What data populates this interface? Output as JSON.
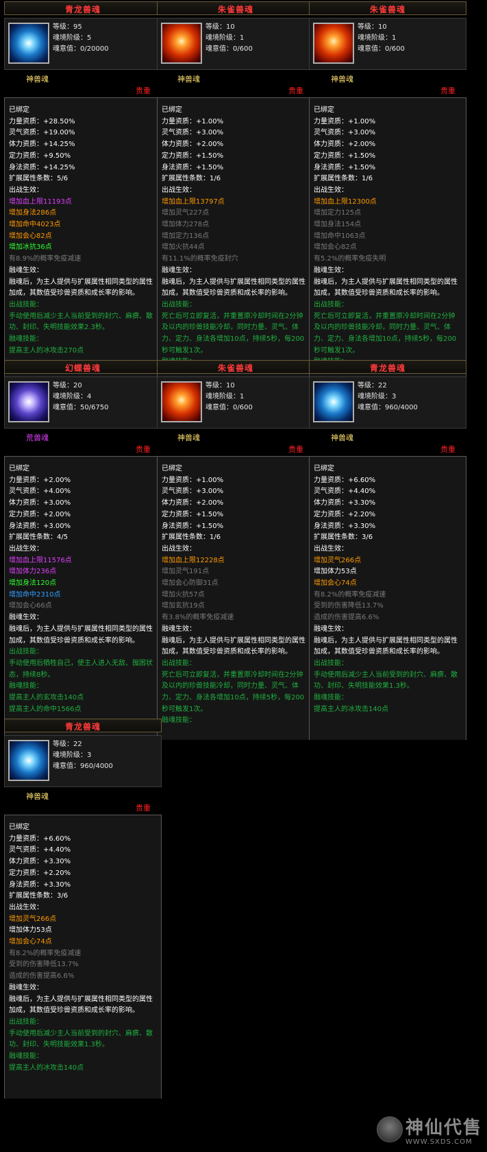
{
  "cards": [
    {
      "title": "青龙兽魂",
      "icon": "qinglong-soul-icon",
      "level": "等级：95",
      "realm": "魂境阶级：5",
      "soul_value": "魂意值：0/20000",
      "soul_type": "神兽魂",
      "soul_type_color": "#ffe070",
      "rarity": "贵重",
      "lines": [
        {
          "text": "已绑定",
          "color": "#ffffff"
        },
        {
          "text": "力量资质：+28.50%",
          "color": "#ffffff"
        },
        {
          "text": "灵气资质：+19.00%",
          "color": "#ffffff"
        },
        {
          "text": "体力资质：+14.25%",
          "color": "#ffffff"
        },
        {
          "text": "定力资质：+9.50%",
          "color": "#ffffff"
        },
        {
          "text": "身法资质：+14.25%",
          "color": "#ffffff"
        },
        {
          "text": "扩展属性条数：5/6",
          "color": "#ffffff"
        },
        {
          "text": "出战生效：",
          "color": "#ffffff"
        },
        {
          "text": "增加血上限11193点",
          "color": "#e040ff"
        },
        {
          "text": "增加身法286点",
          "color": "#ff9a00"
        },
        {
          "text": "增加命中4023点",
          "color": "#ff9a00"
        },
        {
          "text": "增加会心82点",
          "color": "#ff9a00"
        },
        {
          "text": "增加冰抗36点",
          "color": "#30ff30"
        },
        {
          "text": "有8.9%的概率免疫减速",
          "color": "#7a7a7a"
        },
        {
          "text": "融魂生效：",
          "color": "#ffffff"
        },
        {
          "text": "融魂后，为主人提供与扩展属性相同类型的属性加成，其数值受珍兽资质和成长率的影响。",
          "color": "#ffffff"
        },
        {
          "text": "出战技能：",
          "color": "#20b040"
        },
        {
          "text": "手动使用后减少主人当前受到的封穴、麻痹、散功、封印、失明技能效果2.3秒。",
          "color": "#20b040"
        },
        {
          "text": "融魂技能：",
          "color": "#20b040"
        },
        {
          "text": "提高主人的冰攻击270点",
          "color": "#20b040"
        }
      ]
    },
    {
      "title": "朱雀兽魂",
      "icon": "zhuque-soul-icon",
      "level": "等级：10",
      "realm": "魂境阶级：1",
      "soul_value": "魂意值：0/600",
      "soul_type": "神兽魂",
      "soul_type_color": "#ffe070",
      "rarity": "贵重",
      "lines": [
        {
          "text": "已绑定",
          "color": "#ffffff"
        },
        {
          "text": "力量资质：+1.00%",
          "color": "#ffffff"
        },
        {
          "text": "灵气资质：+3.00%",
          "color": "#ffffff"
        },
        {
          "text": "体力资质：+2.00%",
          "color": "#ffffff"
        },
        {
          "text": "定力资质：+1.50%",
          "color": "#ffffff"
        },
        {
          "text": "身法资质：+1.50%",
          "color": "#ffffff"
        },
        {
          "text": "扩展属性条数：1/6",
          "color": "#ffffff"
        },
        {
          "text": "出战生效：",
          "color": "#ffffff"
        },
        {
          "text": "增加血上限13797点",
          "color": "#ff9a00"
        },
        {
          "text": "增加灵气227点",
          "color": "#7a7a7a"
        },
        {
          "text": "增加体力278点",
          "color": "#7a7a7a"
        },
        {
          "text": "增加定力136点",
          "color": "#7a7a7a"
        },
        {
          "text": "增加火抗44点",
          "color": "#7a7a7a"
        },
        {
          "text": "有11.1%的概率免疫封穴",
          "color": "#7a7a7a"
        },
        {
          "text": "融魂生效：",
          "color": "#ffffff"
        },
        {
          "text": "融魂后，为主人提供与扩展属性相同类型的属性加成，其数值受珍兽资质和成长率的影响。",
          "color": "#ffffff"
        },
        {
          "text": "出战技能：",
          "color": "#20b040"
        },
        {
          "text": "死亡后可立即复活，并重置原冷却时间在2分钟及以内的珍兽技能冷却，同时力量、灵气、体力、定力、身法各增加10点，持续5秒，每200秒可触发1次。",
          "color": "#20b040"
        },
        {
          "text": "融魂技能：",
          "color": "#20b040"
        }
      ]
    },
    {
      "title": "朱雀兽魂",
      "icon": "zhuque-soul-icon",
      "level": "等级：10",
      "realm": "魂境阶级：1",
      "soul_value": "魂意值：0/600",
      "soul_type": "神兽魂",
      "soul_type_color": "#ffe070",
      "rarity": "贵重",
      "lines": [
        {
          "text": "已绑定",
          "color": "#ffffff"
        },
        {
          "text": "力量资质：+1.00%",
          "color": "#ffffff"
        },
        {
          "text": "灵气资质：+3.00%",
          "color": "#ffffff"
        },
        {
          "text": "体力资质：+2.00%",
          "color": "#ffffff"
        },
        {
          "text": "定力资质：+1.50%",
          "color": "#ffffff"
        },
        {
          "text": "身法资质：+1.50%",
          "color": "#ffffff"
        },
        {
          "text": "扩展属性条数：1/6",
          "color": "#ffffff"
        },
        {
          "text": "出战生效：",
          "color": "#ffffff"
        },
        {
          "text": "增加血上限12300点",
          "color": "#ff9a00"
        },
        {
          "text": "增加定力125点",
          "color": "#7a7a7a"
        },
        {
          "text": "增加身法154点",
          "color": "#7a7a7a"
        },
        {
          "text": "增加命中1063点",
          "color": "#7a7a7a"
        },
        {
          "text": "增加会心82点",
          "color": "#7a7a7a"
        },
        {
          "text": "有5.2%的概率免疫失明",
          "color": "#7a7a7a"
        },
        {
          "text": "融魂生效：",
          "color": "#ffffff"
        },
        {
          "text": "融魂后，为主人提供与扩展属性相同类型的属性加成，其数值受珍兽资质和成长率的影响。",
          "color": "#ffffff"
        },
        {
          "text": "出战技能：",
          "color": "#20b040"
        },
        {
          "text": "死亡后可立即复活，并重置原冷却时间在2分钟及以内的珍兽技能冷却，同时力量、灵气、体力、定力、身法各增加10点，持续5秒，每200秒可触发1次。",
          "color": "#20b040"
        },
        {
          "text": "融魂技能：",
          "color": "#20b040"
        }
      ]
    },
    {
      "title": "幻蝶兽魂",
      "icon": "huandie-soul-icon",
      "level": "等级：20",
      "realm": "魂境阶级：4",
      "soul_value": "魂意值：50/6750",
      "soul_type": "荒兽魂",
      "soul_type_color": "#e040ff",
      "rarity": "贵重",
      "lines": [
        {
          "text": "已绑定",
          "color": "#ffffff"
        },
        {
          "text": "力量资质：+2.00%",
          "color": "#ffffff"
        },
        {
          "text": "灵气资质：+4.00%",
          "color": "#ffffff"
        },
        {
          "text": "体力资质：+3.00%",
          "color": "#ffffff"
        },
        {
          "text": "定力资质：+2.00%",
          "color": "#ffffff"
        },
        {
          "text": "身法资质：+3.00%",
          "color": "#ffffff"
        },
        {
          "text": "扩展属性条数：4/5",
          "color": "#ffffff"
        },
        {
          "text": "出战生效：",
          "color": "#ffffff"
        },
        {
          "text": "增加血上限11576点",
          "color": "#e040ff"
        },
        {
          "text": "增加体力236点",
          "color": "#e040ff"
        },
        {
          "text": "增加身法120点",
          "color": "#30ff30"
        },
        {
          "text": "增加命中2310点",
          "color": "#30a0ff"
        },
        {
          "text": "增加会心66点",
          "color": "#7a7a7a"
        },
        {
          "text": "融魂生效：",
          "color": "#ffffff"
        },
        {
          "text": "融魂后，为主人提供与扩展属性相同类型的属性加成，其数值受珍兽资质和成长率的影响。",
          "color": "#ffffff"
        },
        {
          "text": "出战技能：",
          "color": "#20b040"
        },
        {
          "text": "手动使用后牺牲自己，使主人进入无敌、囤困状态，持续8秒。",
          "color": "#20b040"
        },
        {
          "text": "融魂技能：",
          "color": "#20b040"
        },
        {
          "text": "提高主人的玄攻击140点",
          "color": "#20b040"
        },
        {
          "text": "提高主人的命中1566点",
          "color": "#20b040"
        }
      ]
    },
    {
      "title": "朱雀兽魂",
      "icon": "zhuque-soul-icon",
      "level": "等级：10",
      "realm": "魂境阶级：1",
      "soul_value": "魂意值：0/600",
      "soul_type": "神兽魂",
      "soul_type_color": "#ffe070",
      "rarity": "贵重",
      "lines": [
        {
          "text": "已绑定",
          "color": "#ffffff"
        },
        {
          "text": "力量资质：+1.00%",
          "color": "#ffffff"
        },
        {
          "text": "灵气资质：+3.00%",
          "color": "#ffffff"
        },
        {
          "text": "体力资质：+2.00%",
          "color": "#ffffff"
        },
        {
          "text": "定力资质：+1.50%",
          "color": "#ffffff"
        },
        {
          "text": "身法资质：+1.50%",
          "color": "#ffffff"
        },
        {
          "text": "扩展属性条数：1/6",
          "color": "#ffffff"
        },
        {
          "text": "出战生效：",
          "color": "#ffffff"
        },
        {
          "text": "增加血上限12228点",
          "color": "#ff9a00"
        },
        {
          "text": "增加灵气191点",
          "color": "#7a7a7a"
        },
        {
          "text": "增加会心防御31点",
          "color": "#7a7a7a"
        },
        {
          "text": "增加火抗57点",
          "color": "#7a7a7a"
        },
        {
          "text": "增加玄抗19点",
          "color": "#7a7a7a"
        },
        {
          "text": "有3.8%的概率免疫减速",
          "color": "#7a7a7a"
        },
        {
          "text": "融魂生效：",
          "color": "#ffffff"
        },
        {
          "text": "融魂后，为主人提供与扩展属性相同类型的属性加成，其数值受珍兽资质和成长率的影响。",
          "color": "#ffffff"
        },
        {
          "text": "出战技能：",
          "color": "#20b040"
        },
        {
          "text": "死亡后可立即复活，并重置原冷却时间在2分钟及以内的珍兽技能冷却，同时力量、灵气、体力、定力、身法各增加10点，持续5秒，每200秒可触发1次。",
          "color": "#20b040"
        },
        {
          "text": "融魂技能：",
          "color": "#20b040"
        }
      ]
    },
    {
      "title": "青龙兽魂",
      "icon": "qinglong-soul-icon",
      "level": "等级：22",
      "realm": "魂境阶级：3",
      "soul_value": "魂意值：960/4000",
      "soul_type": "神兽魂",
      "soul_type_color": "#ffe070",
      "rarity": "贵重",
      "lines": [
        {
          "text": "已绑定",
          "color": "#ffffff"
        },
        {
          "text": "力量资质：+6.60%",
          "color": "#ffffff"
        },
        {
          "text": "灵气资质：+4.40%",
          "color": "#ffffff"
        },
        {
          "text": "体力资质：+3.30%",
          "color": "#ffffff"
        },
        {
          "text": "定力资质：+2.20%",
          "color": "#ffffff"
        },
        {
          "text": "身法资质：+3.30%",
          "color": "#ffffff"
        },
        {
          "text": "扩展属性条数：3/6",
          "color": "#ffffff"
        },
        {
          "text": "出战生效：",
          "color": "#ffffff"
        },
        {
          "text": "增加灵气266点",
          "color": "#ff9a00"
        },
        {
          "text": "增加体力53点",
          "color": "#ffffff"
        },
        {
          "text": "增加会心74点",
          "color": "#ff9a00"
        },
        {
          "text": "有8.2%的概率免疫减速",
          "color": "#7a7a7a"
        },
        {
          "text": "受到的伤害降低13.7%",
          "color": "#7a7a7a"
        },
        {
          "text": "造成的伤害提高6.6%",
          "color": "#7a7a7a"
        },
        {
          "text": "融魂生效：",
          "color": "#ffffff"
        },
        {
          "text": "融魂后，为主人提供与扩展属性相同类型的属性加成，其数值受珍兽资质和成长率的影响。",
          "color": "#ffffff"
        },
        {
          "text": "出战技能：",
          "color": "#20b040"
        },
        {
          "text": "手动使用后减少主人当前受到的封穴、麻痹、散功、封印、失明技能效果1.3秒。",
          "color": "#20b040"
        },
        {
          "text": "融魂技能：",
          "color": "#20b040"
        },
        {
          "text": "提高主人的冰攻击140点",
          "color": "#20b040"
        }
      ]
    },
    {
      "title": "青龙兽魂",
      "icon": "qinglong-soul-icon",
      "level": "等级：22",
      "realm": "魂境阶级：3",
      "soul_value": "魂意值：960/4000",
      "soul_type": "神兽魂",
      "soul_type_color": "#ffe070",
      "rarity": "贵重",
      "lines": [
        {
          "text": "已绑定",
          "color": "#ffffff"
        },
        {
          "text": "力量资质：+6.60%",
          "color": "#ffffff"
        },
        {
          "text": "灵气资质：+4.40%",
          "color": "#ffffff"
        },
        {
          "text": "体力资质：+3.30%",
          "color": "#ffffff"
        },
        {
          "text": "定力资质：+2.20%",
          "color": "#ffffff"
        },
        {
          "text": "身法资质：+3.30%",
          "color": "#ffffff"
        },
        {
          "text": "扩展属性条数：3/6",
          "color": "#ffffff"
        },
        {
          "text": "出战生效：",
          "color": "#ffffff"
        },
        {
          "text": "增加灵气266点",
          "color": "#ff9a00"
        },
        {
          "text": "增加体力53点",
          "color": "#ffffff"
        },
        {
          "text": "增加会心74点",
          "color": "#ff9a00"
        },
        {
          "text": "有8.2%的概率免疫减速",
          "color": "#7a7a7a"
        },
        {
          "text": "受到的伤害降低13.7%",
          "color": "#7a7a7a"
        },
        {
          "text": "造成的伤害提高6.6%",
          "color": "#7a7a7a"
        },
        {
          "text": "融魂生效：",
          "color": "#ffffff"
        },
        {
          "text": "融魂后，为主人提供与扩展属性相同类型的属性加成，其数值受珍兽资质和成长率的影响。",
          "color": "#ffffff"
        },
        {
          "text": "出战技能：",
          "color": "#20b040"
        },
        {
          "text": "手动使用后减少主人当前受到的封穴、麻痹、散功、封印、失明技能效果1.3秒。",
          "color": "#20b040"
        },
        {
          "text": "融魂技能：",
          "color": "#20b040"
        },
        {
          "text": "提高主人的冰攻击140点",
          "color": "#20b040"
        }
      ]
    }
  ],
  "watermark": {
    "brand": "神仙代售",
    "url": "WWW.SXDS.COM"
  }
}
